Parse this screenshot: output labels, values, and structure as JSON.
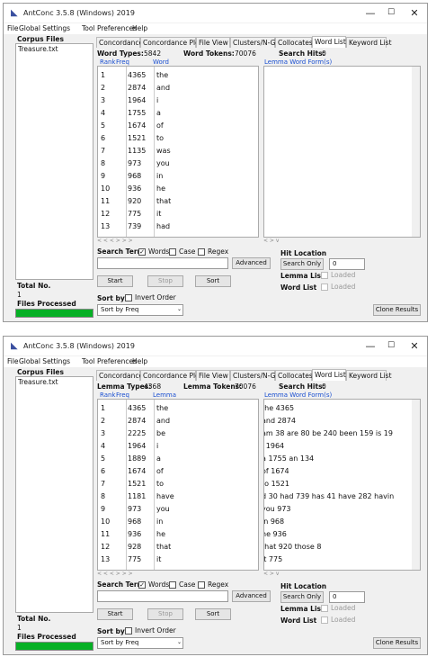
{
  "app": {
    "title": "AntConc 3.5.8 (Windows) 2019",
    "min": "—",
    "max": "☐",
    "close": "✕"
  },
  "menu": [
    "File",
    "Global Settings",
    "Tool Preferences",
    "Help"
  ],
  "left": {
    "corpus_files_label": "Corpus Files",
    "file": "Treasure.txt",
    "total_no_label": "Total No.",
    "total_no": "1",
    "files_processed_label": "Files Processed"
  },
  "tabs": [
    "Concordance",
    "Concordance Plot",
    "File View",
    "Clusters/N-Grams",
    "Collocates",
    "Word List",
    "Keyword List"
  ],
  "win1": {
    "types_label": "Word Types:",
    "types": "5842",
    "tokens_label": "Word Tokens:",
    "tokens": "70076",
    "hits_label": "Search Hits:",
    "hits": "0",
    "col_rank": "Rank",
    "col_freq": "Freq",
    "col_word": "Word",
    "col_lemma": "Lemma Word Form(s)",
    "rows": [
      [
        "1",
        "4365",
        "the"
      ],
      [
        "2",
        "2874",
        "and"
      ],
      [
        "3",
        "1964",
        "i"
      ],
      [
        "4",
        "1755",
        "a"
      ],
      [
        "5",
        "1674",
        "of"
      ],
      [
        "6",
        "1521",
        "to"
      ],
      [
        "7",
        "1135",
        "was"
      ],
      [
        "8",
        "973",
        "you"
      ],
      [
        "9",
        "968",
        "in"
      ],
      [
        "10",
        "936",
        "he"
      ],
      [
        "11",
        "920",
        "that"
      ],
      [
        "12",
        "775",
        "it"
      ],
      [
        "13",
        "739",
        "had"
      ]
    ]
  },
  "win2": {
    "types_label": "Lemma Types:",
    "types": "4368",
    "tokens_label": "Lemma Tokens:",
    "tokens": "70076",
    "hits_label": "Search Hits:",
    "hits": "0",
    "col_rank": "Rank",
    "col_freq": "Freq",
    "col_word": "Lemma",
    "col_lemma": "Lemma Word Form(s)",
    "rows": [
      [
        "1",
        "4365",
        "the",
        "the 4365"
      ],
      [
        "2",
        "2874",
        "and",
        "and 2874"
      ],
      [
        "3",
        "2225",
        "be",
        "am 38 are 80 be 240 been 159 is 19"
      ],
      [
        "4",
        "1964",
        "i",
        "i 1964"
      ],
      [
        "5",
        "1889",
        "a",
        "a 1755 an 134"
      ],
      [
        "6",
        "1674",
        "of",
        "of 1674"
      ],
      [
        "7",
        "1521",
        "to",
        "to 1521"
      ],
      [
        "8",
        "1181",
        "have",
        "d 30 had 739 has 41 have 282 havin"
      ],
      [
        "9",
        "973",
        "you",
        "you 973"
      ],
      [
        "10",
        "968",
        "in",
        "in 968"
      ],
      [
        "11",
        "936",
        "he",
        "he 936"
      ],
      [
        "12",
        "928",
        "that",
        "that 920 those 8"
      ],
      [
        "13",
        "775",
        "it",
        "it 775"
      ]
    ]
  },
  "search": {
    "term_label": "Search Term",
    "words_label": "Words",
    "case_label": "Case",
    "regex_label": "Regex",
    "advanced": "Advanced",
    "hit_location": "Hit Location",
    "search_only": "Search Only",
    "hit_value": "0",
    "start": "Start",
    "stop": "Stop",
    "sort": "Sort",
    "lemma_list": "Lemma List",
    "word_list": "Word List",
    "loaded": "Loaded",
    "sort_by_label": "Sort by",
    "invert_order": "Invert Order",
    "sort_select": "Sort by Freq",
    "clone": "Clone Results"
  }
}
